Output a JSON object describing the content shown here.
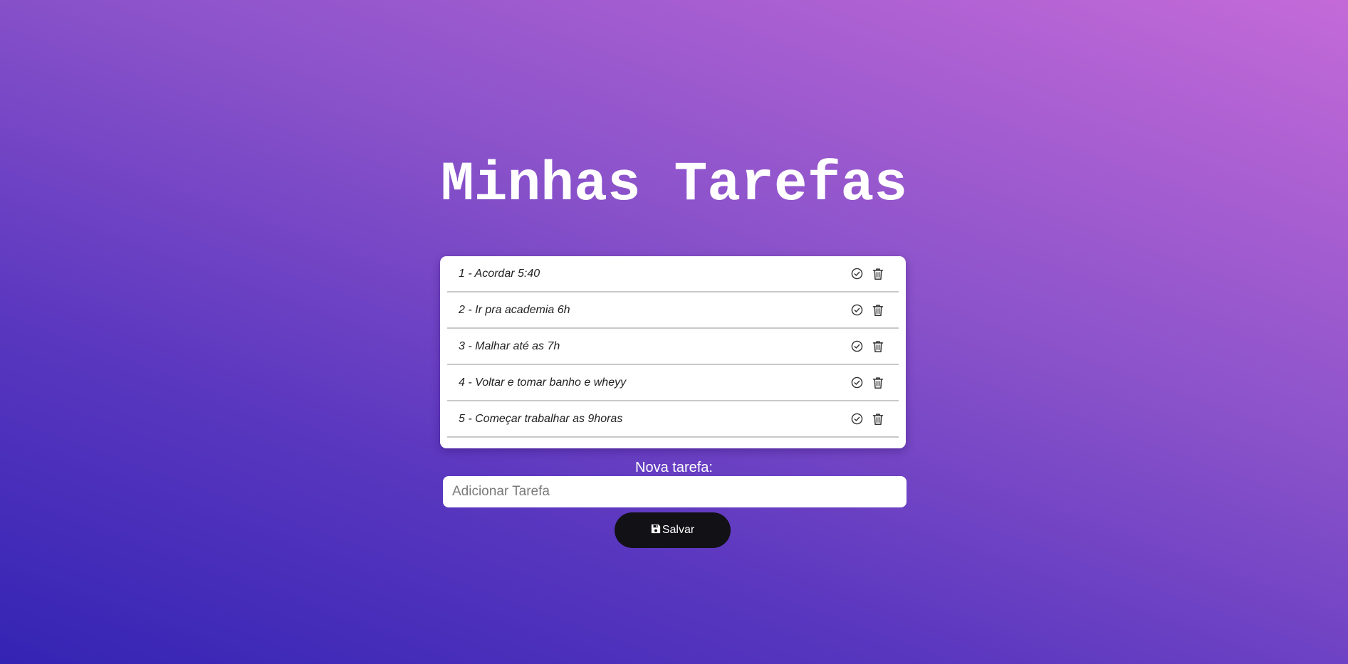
{
  "page": {
    "title": "Minhas Tarefas"
  },
  "tasks": [
    {
      "text": "1 - Acordar 5:40"
    },
    {
      "text": "2 - Ir pra academia 6h"
    },
    {
      "text": "3 - Malhar até as 7h"
    },
    {
      "text": "4 - Voltar e tomar banho e wheyy"
    },
    {
      "text": "5 - Começar trabalhar as 9horas"
    }
  ],
  "task_actions": {
    "complete_icon": "check-circle-icon",
    "delete_icon": "trash-icon"
  },
  "form": {
    "label": "Nova tarefa:",
    "input_value": "",
    "input_placeholder": "Adicionar Tarefa",
    "save_label": "Salvar",
    "save_icon": "floppy-disk-icon"
  },
  "colors": {
    "gradient_start": "#3424b4",
    "gradient_end": "#c46ad8",
    "button_bg": "#121116",
    "card_bg": "#ffffff"
  }
}
